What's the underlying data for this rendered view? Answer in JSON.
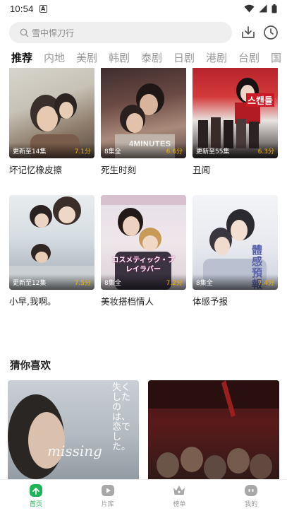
{
  "status": {
    "time": "10:54",
    "notif": "A"
  },
  "search": {
    "placeholder": "雪中悍刀行"
  },
  "tabs": [
    {
      "label": "推荐",
      "active": true
    },
    {
      "label": "内地"
    },
    {
      "label": "美剧"
    },
    {
      "label": "韩剧"
    },
    {
      "label": "泰剧"
    },
    {
      "label": "日剧"
    },
    {
      "label": "港剧"
    },
    {
      "label": "台剧"
    },
    {
      "label": "国"
    }
  ],
  "row1": [
    {
      "title": "坏记忆橡皮擦",
      "ep": "更新至14集",
      "score": "7.1分"
    },
    {
      "title": "死生时刻",
      "ep": "8集全",
      "score": "6.6分"
    },
    {
      "title": "丑闻",
      "ep": "更新至55集",
      "score": "6.3分"
    }
  ],
  "row2": [
    {
      "title": "小早,我啊。",
      "ep": "更新至12集",
      "score": "7.5分"
    },
    {
      "title": "美妆搭档情人",
      "ep": "8集全",
      "score": "7.2分"
    },
    {
      "title": "体感予报",
      "ep": "8集全",
      "score": "7.4分"
    }
  ],
  "poster_text": {
    "p1": "4MINUTES",
    "p2": "스캔들",
    "p3": "コスメティック・プレイラバー",
    "p4": "體感預報",
    "p5": "missing",
    "p6": "失くしたのは、恋でした。"
  },
  "section": {
    "title": "猜你喜欢"
  },
  "nav": [
    {
      "label": "首页",
      "active": true
    },
    {
      "label": "片库"
    },
    {
      "label": "榜单"
    },
    {
      "label": "我的"
    }
  ],
  "colors": {
    "accent": "#1fb45a",
    "score": "#f5b301"
  }
}
